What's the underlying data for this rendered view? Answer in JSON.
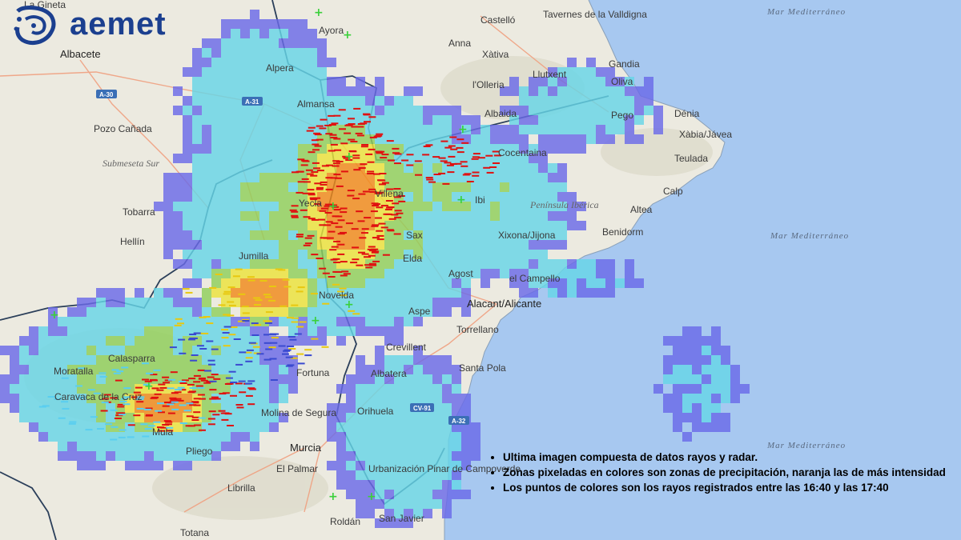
{
  "logo": {
    "text": "aemet",
    "icon": "aemet-emblem-icon"
  },
  "sea_labels": [
    {
      "id": "sea-top",
      "text": "Mar Mediterráneo"
    },
    {
      "id": "sea-mid",
      "text": "Mar Mediterráneo"
    },
    {
      "id": "sea-bot",
      "text": "Mar Mediterráneo"
    }
  ],
  "regions": [
    {
      "id": "submeseta",
      "text": "Submeseta Sur"
    },
    {
      "id": "peninsula",
      "text": "Península Ibérica"
    }
  ],
  "roads": [
    "A-30",
    "A-31",
    "CV-91",
    "A-32"
  ],
  "places": [
    "La Gineta",
    "Albacete",
    "Ayora",
    "Castelló",
    "Tavernes de la Valldigna",
    "Anna",
    "Xàtiva",
    "Llutxent",
    "Gandia",
    "Oliva",
    "l'Olleria",
    "Albaida",
    "Pego",
    "Dénia",
    "Xàbia/Jávea",
    "Alpera",
    "Almansa",
    "Pozo Cañada",
    "Cocentaina",
    "Teulada",
    "Yecla",
    "Villena",
    "Ibi",
    "Calp",
    "Tobarra",
    "Altea",
    "Hellín",
    "Benidorm",
    "Sax",
    "Xixona/Jijona",
    "Jumilla",
    "Elda",
    "Agost",
    "el Campello",
    "Novelda",
    "Alacant/Alicante",
    "Aspe",
    "Torrellano",
    "Calasparra",
    "Crevillent",
    "Moratalla",
    "Fortuna",
    "Albatera",
    "Santa Pola",
    "Caravaca de la Cruz",
    "Orihuela",
    "Molina de Segura",
    "Mula",
    "Murcia",
    "Pliego",
    "El Palmar",
    "Urbanización Pinar de Campoverde",
    "Librilla",
    "Roldán",
    "San Javier",
    "Totana"
  ],
  "legend": [
    "Ultima imagen compuesta de datos rayos y radar.",
    "Zonas pixeladas en colores son zonas de precipitación, naranja las de más intensidad",
    "Los puntos de colores son los rayos registrados entre las 16:40 y las 17:40"
  ],
  "colors": {
    "sea": "#a7c8f0",
    "land": "#eceae0",
    "precip_low": "#6a6ae8",
    "precip_mid": "#66d6e6",
    "precip_green": "#8fd05a",
    "precip_yellow": "#ece33a",
    "precip_orange": "#f08a1a",
    "lightning_red": "#e01010",
    "lightning_positive": "#3ad03a",
    "border": "#2b3f5a"
  }
}
